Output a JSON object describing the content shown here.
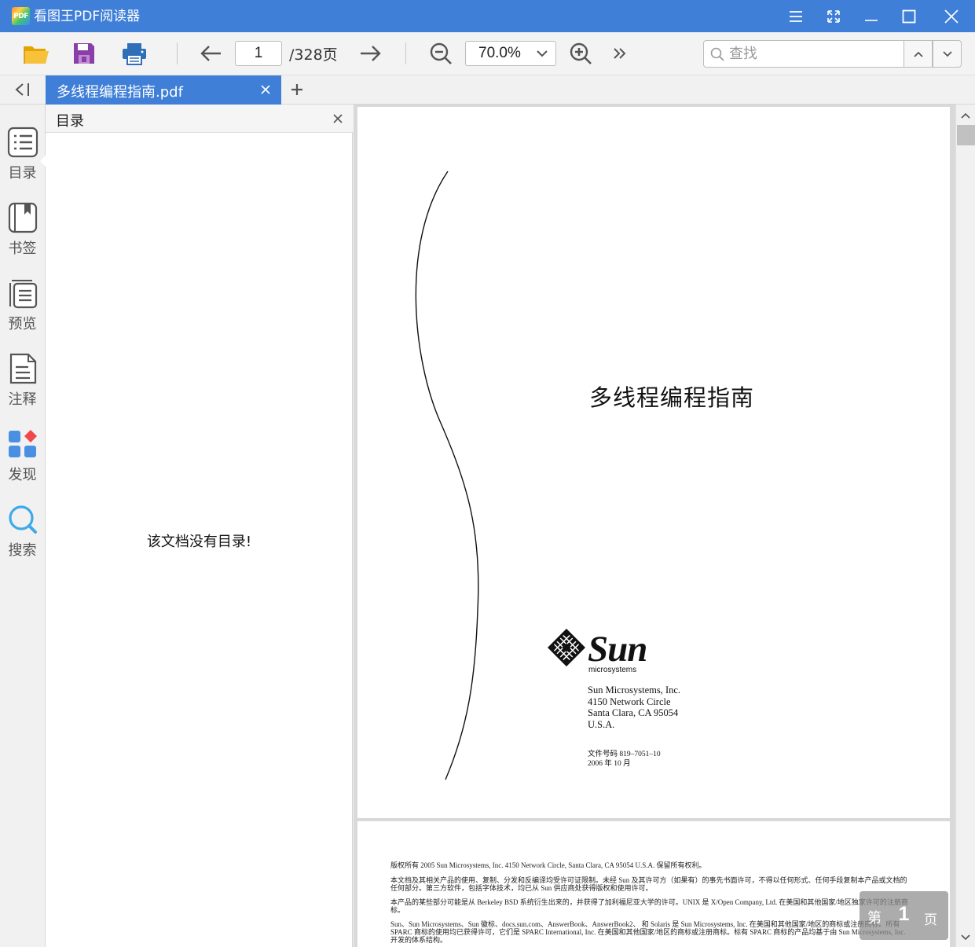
{
  "app": {
    "logo_text": "PDF",
    "title": "看图王PDF阅读器"
  },
  "toolbar": {
    "current_page": "1",
    "total_pages": "/328页",
    "zoom": "70.0%",
    "search_placeholder": "查找"
  },
  "tabs": [
    {
      "label": "多线程编程指南.pdf",
      "active": true
    }
  ],
  "leftnav": {
    "items": [
      {
        "label": "目录",
        "icon": "toc-list-icon"
      },
      {
        "label": "书签",
        "icon": "bookmark-icon"
      },
      {
        "label": "预览",
        "icon": "page-preview-icon"
      },
      {
        "label": "注释",
        "icon": "annotation-icon"
      },
      {
        "label": "发现",
        "icon": "discover-apps-icon"
      },
      {
        "label": "搜索",
        "icon": "search-icon"
      }
    ]
  },
  "sidepanel": {
    "title": "目录",
    "empty_message": "该文档没有目录!"
  },
  "document": {
    "page1": {
      "title": "多线程编程指南",
      "logo_word": "Sun",
      "logo_sub": "microsystems",
      "address": [
        "Sun Microsystems, Inc.",
        "4150 Network Circle",
        "Santa Clara, CA 95054",
        "U.S.A."
      ],
      "doc_number": "文件号码 819–7051–10",
      "date": "2006 年 10 月"
    },
    "page2": {
      "legal": [
        "版权所有 2005 Sun Microsystems, Inc.     4150 Network Circle, Santa Clara, CA 95054 U.S.A.     保留所有权利。",
        "本文档及其相关产品的使用、复制、分发和反编译均受许可证限制。未经 Sun 及其许可方（如果有）的事先书面许可，不得以任何形式、任何手段复制本产品或文档的任何部分。第三方软件，包括字体技术，均已从 Sun 供应商处获得版权和使用许可。",
        "本产品的某些部分可能是从 Berkeley BSD 系统衍生出来的，并获得了加利福尼亚大学的许可。UNIX 是 X/Open Company, Ltd. 在美国和其他国家/地区独家许可的注册商标。",
        "Sun、Sun Microsystems、Sun 徽标、docs.sun.com、AnswerBook、AnswerBook2、 和 Solaris 是 Sun Microsystems, Inc. 在美国和其他国家/地区的商标或注册商标。所有 SPARC 商标的使用均已获得许可，它们是 SPARC International, Inc. 在美国和其他国家/地区的商标或注册商标。标有 SPARC 商标的产品均基于由 Sun Microsystems, Inc. 开发的体系结构。"
      ]
    }
  },
  "page_indicator": {
    "prefix": "第",
    "number": "1",
    "suffix": "页"
  },
  "colors": {
    "accent": "#3f7fd8",
    "save_purple": "#8a3fa8",
    "print_blue": "#2f6fb8",
    "folder_yellow": "#f4b400"
  }
}
